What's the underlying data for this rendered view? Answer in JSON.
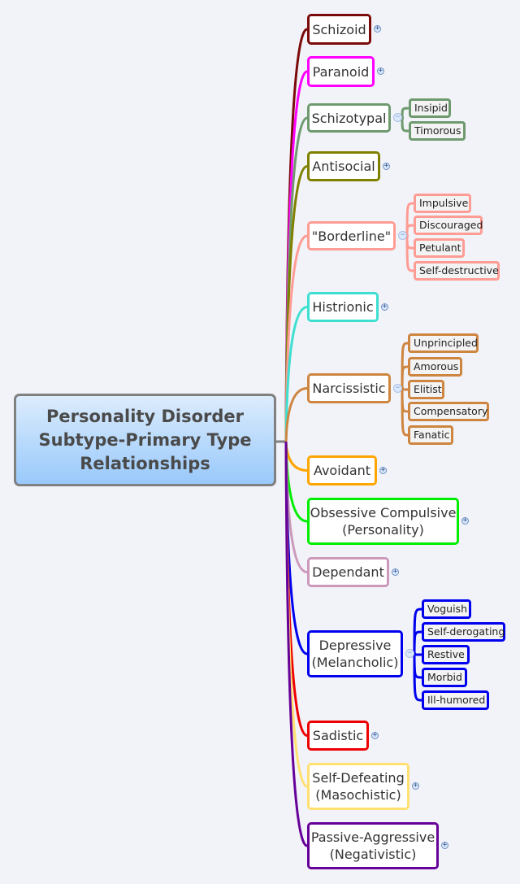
{
  "root": {
    "title_lines": [
      "Personality Disorder",
      "Subtype-Primary Type",
      "Relationships"
    ]
  },
  "branches": [
    {
      "id": "schizoid",
      "lines": [
        "Schizoid"
      ],
      "color": "#7b0a0a",
      "state": "collapsed",
      "children": []
    },
    {
      "id": "paranoid",
      "lines": [
        "Paranoid"
      ],
      "color": "#ff00ff",
      "state": "collapsed",
      "children": []
    },
    {
      "id": "schizotypal",
      "lines": [
        "Schizotypal"
      ],
      "color": "#6f9a6f",
      "state": "expanded",
      "children": [
        "Insipid",
        "Timorous"
      ]
    },
    {
      "id": "antisocial",
      "lines": [
        "Antisocial"
      ],
      "color": "#808000",
      "state": "collapsed",
      "children": []
    },
    {
      "id": "borderline",
      "lines": [
        "\"Borderline\""
      ],
      "color": "#ff9c94",
      "state": "expanded",
      "children": [
        "Impulsive",
        "Discouraged",
        "Petulant",
        "Self-destructive"
      ]
    },
    {
      "id": "histrionic",
      "lines": [
        "Histrionic"
      ],
      "color": "#3ddfd0",
      "state": "collapsed",
      "children": []
    },
    {
      "id": "narcissistic",
      "lines": [
        "Narcissistic"
      ],
      "color": "#cd853f",
      "state": "expanded",
      "children": [
        "Unprincipled",
        "Amorous",
        "Elitist",
        "Compensatory",
        "Fanatic"
      ]
    },
    {
      "id": "avoidant",
      "lines": [
        "Avoidant"
      ],
      "color": "#ffa500",
      "state": "collapsed",
      "children": []
    },
    {
      "id": "obsessive-compulsive",
      "lines": [
        "Obsessive Compulsive",
        "(Personality)"
      ],
      "color": "#00ee00",
      "state": "collapsed",
      "children": []
    },
    {
      "id": "dependant",
      "lines": [
        "Dependant"
      ],
      "color": "#cc99bb",
      "state": "collapsed",
      "children": []
    },
    {
      "id": "depressive",
      "lines": [
        "Depressive",
        "(Melancholic)"
      ],
      "color": "#0000ee",
      "state": "expanded",
      "children": [
        "Voguish",
        "Self-derogating",
        "Restive",
        "Morbid",
        "Ill-humored"
      ]
    },
    {
      "id": "sadistic",
      "lines": [
        "Sadistic"
      ],
      "color": "#ee0000",
      "state": "collapsed",
      "children": []
    },
    {
      "id": "self-defeating",
      "lines": [
        "Self-Defeating",
        "(Masochistic)"
      ],
      "color": "#ffe070",
      "state": "collapsed",
      "children": []
    },
    {
      "id": "passive-aggressive",
      "lines": [
        "Passive-Aggressive",
        "(Negativistic)"
      ],
      "color": "#660099",
      "state": "collapsed",
      "children": []
    }
  ],
  "icons": {
    "expand": "+",
    "collapse": "−"
  }
}
